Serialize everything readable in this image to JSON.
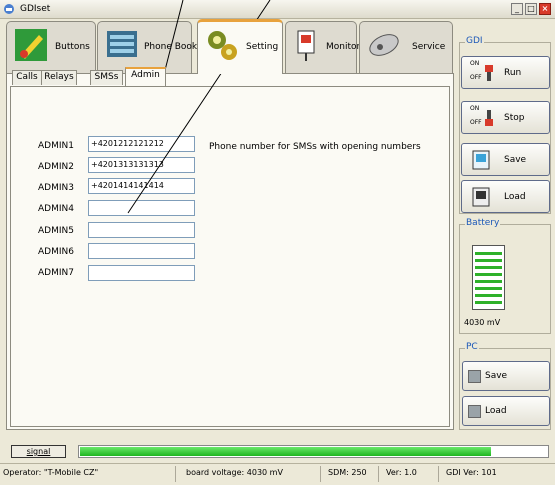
{
  "window": {
    "title": "GDIset"
  },
  "top_tabs": [
    {
      "label": "Buttons",
      "icon": "buttons-icon"
    },
    {
      "label": "Phone Book",
      "icon": "phonebook-icon"
    },
    {
      "label": "Setting",
      "icon": "gears-icon",
      "active": true
    },
    {
      "label": "Monitor",
      "icon": "monitor-icon"
    },
    {
      "label": "Service",
      "icon": "service-icon"
    }
  ],
  "sub_tabs": [
    {
      "label": "Calls"
    },
    {
      "label": "Relays"
    },
    {
      "label": "SMSs"
    },
    {
      "label": "Admin",
      "active": true
    }
  ],
  "admin": {
    "description": "Phone number for SMSs with opening numbers",
    "rows": [
      {
        "label": "ADMIN1",
        "value": "+4201212121212"
      },
      {
        "label": "ADMIN2",
        "value": "+4201313131313"
      },
      {
        "label": "ADMIN3",
        "value": "+4201414141414"
      },
      {
        "label": "ADMIN4",
        "value": ""
      },
      {
        "label": "ADMIN5",
        "value": ""
      },
      {
        "label": "ADMIN6",
        "value": ""
      },
      {
        "label": "ADMIN7",
        "value": ""
      }
    ]
  },
  "gdi_group": {
    "label": "GDI",
    "run": "Run",
    "stop": "Stop",
    "save": "Save",
    "load": "Load",
    "on": "ON",
    "off": "OFF"
  },
  "battery": {
    "label": "Battery",
    "value": "4030 mV",
    "level_fraction": 1.0
  },
  "pc_group": {
    "label": "PC",
    "save": "Save",
    "load": "Load"
  },
  "signal": {
    "button": "signal",
    "level_fraction": 0.88
  },
  "status": {
    "operator": "Operator: \"T-Mobile CZ\"",
    "voltage": "board voltage: 4030 mV",
    "sdm": "SDM: 250",
    "ver": "Ver: 1.0",
    "gdi_ver": "GDI Ver: 101"
  },
  "colors": {
    "accent": "#e8a23d",
    "group_label": "#1c58b8",
    "signal": "#1fb51f",
    "battery": "#2fb12a"
  }
}
